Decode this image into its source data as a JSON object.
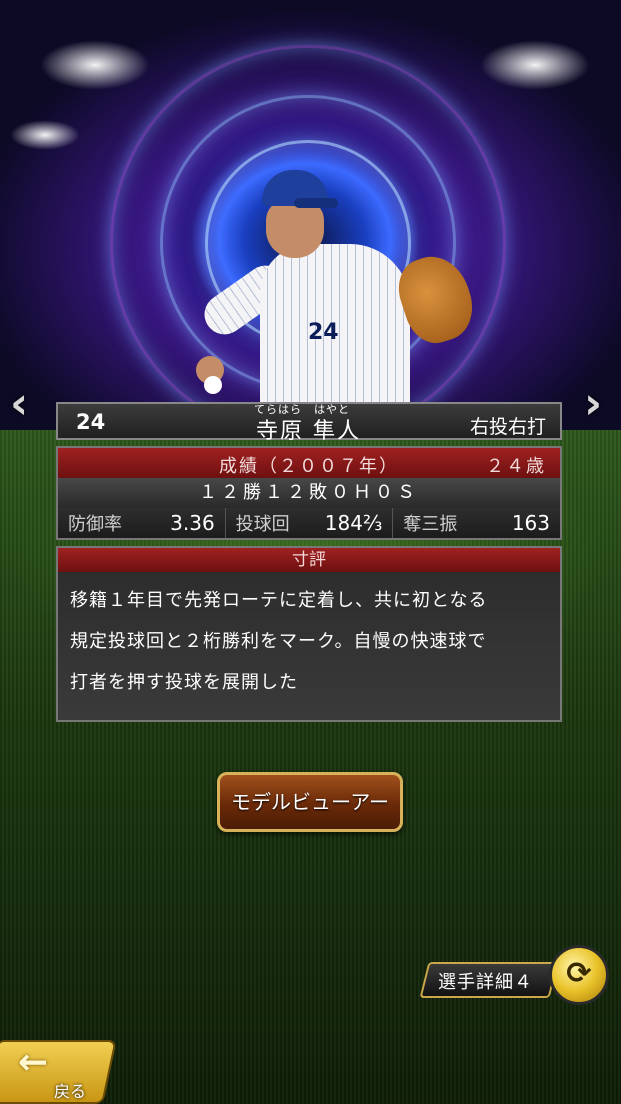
{
  "player": {
    "number": "24",
    "furigana": "てらはら　はやと",
    "name": "寺原 隼人",
    "throws_bats": "右投右打"
  },
  "stats": {
    "season_label": "成績（２００７年）",
    "age": "２４歳",
    "record": "１２勝１２敗０Ｈ０Ｓ",
    "era_label": "防御率",
    "era_value": "3.36",
    "innings_label": "投球回",
    "innings_value": "184⅔",
    "strikeouts_label": "奪三振",
    "strikeouts_value": "163"
  },
  "comment": {
    "heading": "寸評",
    "lines": [
      "移籍１年目で先発ローテに定着し、共に初となる",
      "規定投球回と２桁勝利をマーク。自慢の快速球で",
      "打者を押す投球を展開した"
    ]
  },
  "buttons": {
    "model_viewer": "モデルビューアー",
    "detail_tag": "選手詳細４",
    "back": "戻る"
  },
  "icons": {
    "prev": "chevron-left-icon",
    "next": "chevron-right-icon",
    "cycle": "cycle-arrows-icon",
    "back": "back-arrow-icon"
  },
  "colors": {
    "header_red": "#a02121",
    "button_brown": "#6a2a08",
    "gold": "#e9c22a"
  }
}
